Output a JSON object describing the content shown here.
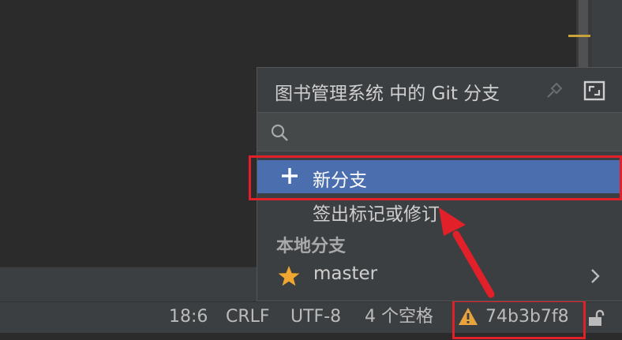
{
  "popup": {
    "title": "图书管理系统 中的 Git 分支",
    "search": {
      "value": "",
      "placeholder": ""
    },
    "actions": {
      "new_branch": "新分支",
      "checkout_tag": "签出标记或修订..."
    },
    "local_section": "本地分支",
    "branches": [
      {
        "name": "master",
        "icon": "star-icon"
      }
    ]
  },
  "status_bar": {
    "position": "18:6",
    "line_separator": "CRLF",
    "encoding": "UTF-8",
    "indent": "4 个空格",
    "git_revision": "74b3b7f8"
  },
  "colors": {
    "selection": "#4b6eaf",
    "highlight_box": "#e2202a",
    "star": "#f0a732",
    "warning": "#e8a33c"
  }
}
